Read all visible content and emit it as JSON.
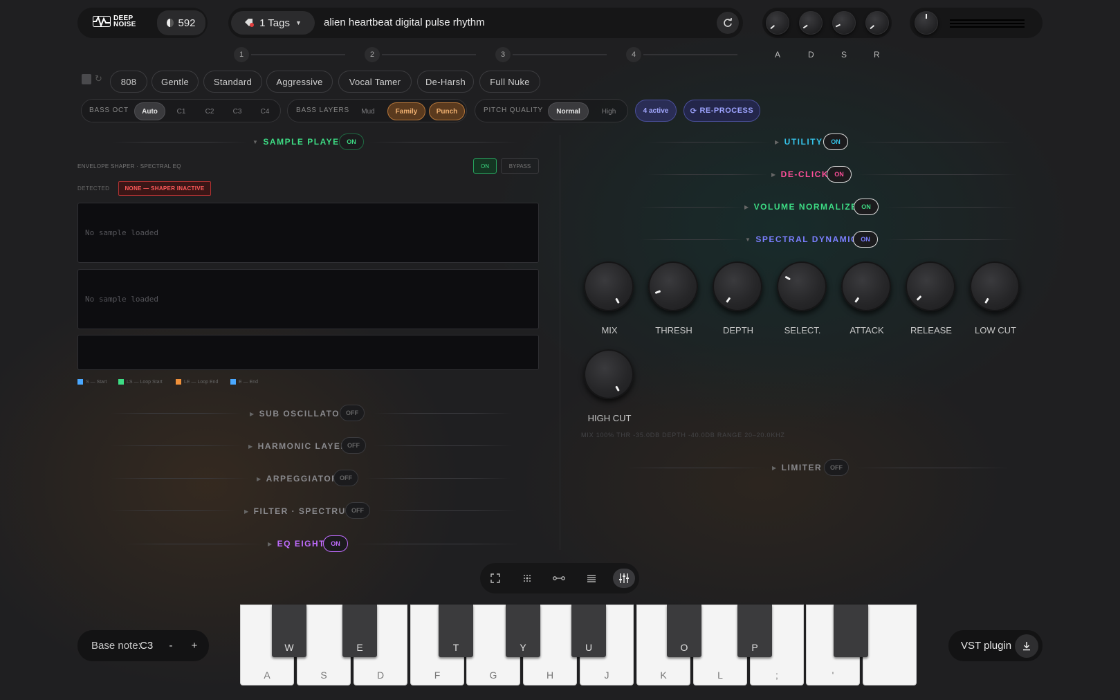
{
  "header": {
    "logo_line1": "DEEP",
    "logo_line2": "NOISE",
    "credits": "592",
    "tags_label": "1 Tags",
    "prompt": "alien heartbeat digital pulse rhythm"
  },
  "steps": [
    "1",
    "2",
    "3",
    "4"
  ],
  "adsr": {
    "labels": [
      "A",
      "D",
      "S",
      "R"
    ]
  },
  "presets": [
    "808",
    "Gentle",
    "Standard",
    "Aggressive",
    "Vocal Tamer",
    "De-Harsh",
    "Full Nuke"
  ],
  "bass_oct": {
    "label": "BASS OCT",
    "options": [
      "Auto",
      "C1",
      "C2",
      "C3",
      "C4"
    ],
    "selected": "Auto"
  },
  "bass_layers": {
    "label": "BASS LAYERS",
    "options": [
      "Mud",
      "Family",
      "Punch"
    ],
    "active": [
      "Family",
      "Punch"
    ]
  },
  "pitch_quality": {
    "label": "PITCH QUALITY",
    "options": [
      "Normal",
      "High"
    ],
    "selected": "Normal"
  },
  "active_count": "4 active",
  "reprocess_label": "RE-PROCESS",
  "sample_player": {
    "title": "SAMPLE PLAYER",
    "state": "ON",
    "subtitle": "ENVELOPE SHAPER · SPECTRAL EQ",
    "on_label": "ON",
    "bypass_label": "BYPASS",
    "detected_label": "DETECTED",
    "detected_value": "NONE — SHAPER INACTIVE",
    "empty_1": "No sample loaded",
    "empty_2": "No sample loaded",
    "legend": [
      "S — Start",
      "LS — Loop Start",
      "LE — Loop End",
      "E — End"
    ]
  },
  "left_sections": [
    {
      "title": "SUB OSCILLATOR",
      "state": "OFF"
    },
    {
      "title": "HARMONIC LAYER",
      "state": "OFF"
    },
    {
      "title": "ARPEGGIATOR",
      "state": "OFF"
    },
    {
      "title": "FILTER · SPECTRUM",
      "state": "OFF"
    },
    {
      "title": "EQ EIGHT",
      "state": "ON"
    }
  ],
  "right_sections": [
    {
      "title": "UTILITY",
      "state": "ON"
    },
    {
      "title": "DE-CLICK",
      "state": "ON"
    },
    {
      "title": "VOLUME NORMALIZER",
      "state": "ON"
    },
    {
      "title": "SPECTRAL DYNAMICS",
      "state": "ON"
    },
    {
      "title": "LIMITER",
      "state": "OFF"
    }
  ],
  "spectral_knobs": [
    "MIX",
    "THRESH",
    "DEPTH",
    "SELECT.",
    "ATTACK",
    "RELEASE",
    "LOW CUT",
    "HIGH CUT"
  ],
  "spectral_readout": "MIX 100%   THR -35.0DB   DEPTH -40.0DB   RANGE 20–20.0KHZ",
  "keyboard": {
    "white_keys": [
      "A",
      "S",
      "D",
      "F",
      "G",
      "H",
      "J",
      "K",
      "L",
      ";",
      "'",
      ""
    ],
    "black_keys": [
      "W",
      "E",
      "T",
      "Y",
      "U",
      "O",
      "P",
      ""
    ]
  },
  "base_note": {
    "label": "Base note:",
    "value": "C3",
    "minus": "-",
    "plus": "+"
  },
  "vst_label": "VST plugin",
  "colors": {
    "green": "#3ddc84",
    "cyan": "#35c2e8",
    "pink": "#ff4f9a",
    "indigo": "#7b7fff",
    "purple": "#c06cff",
    "orange": "#f0a060",
    "red": "#ff5a5a"
  }
}
